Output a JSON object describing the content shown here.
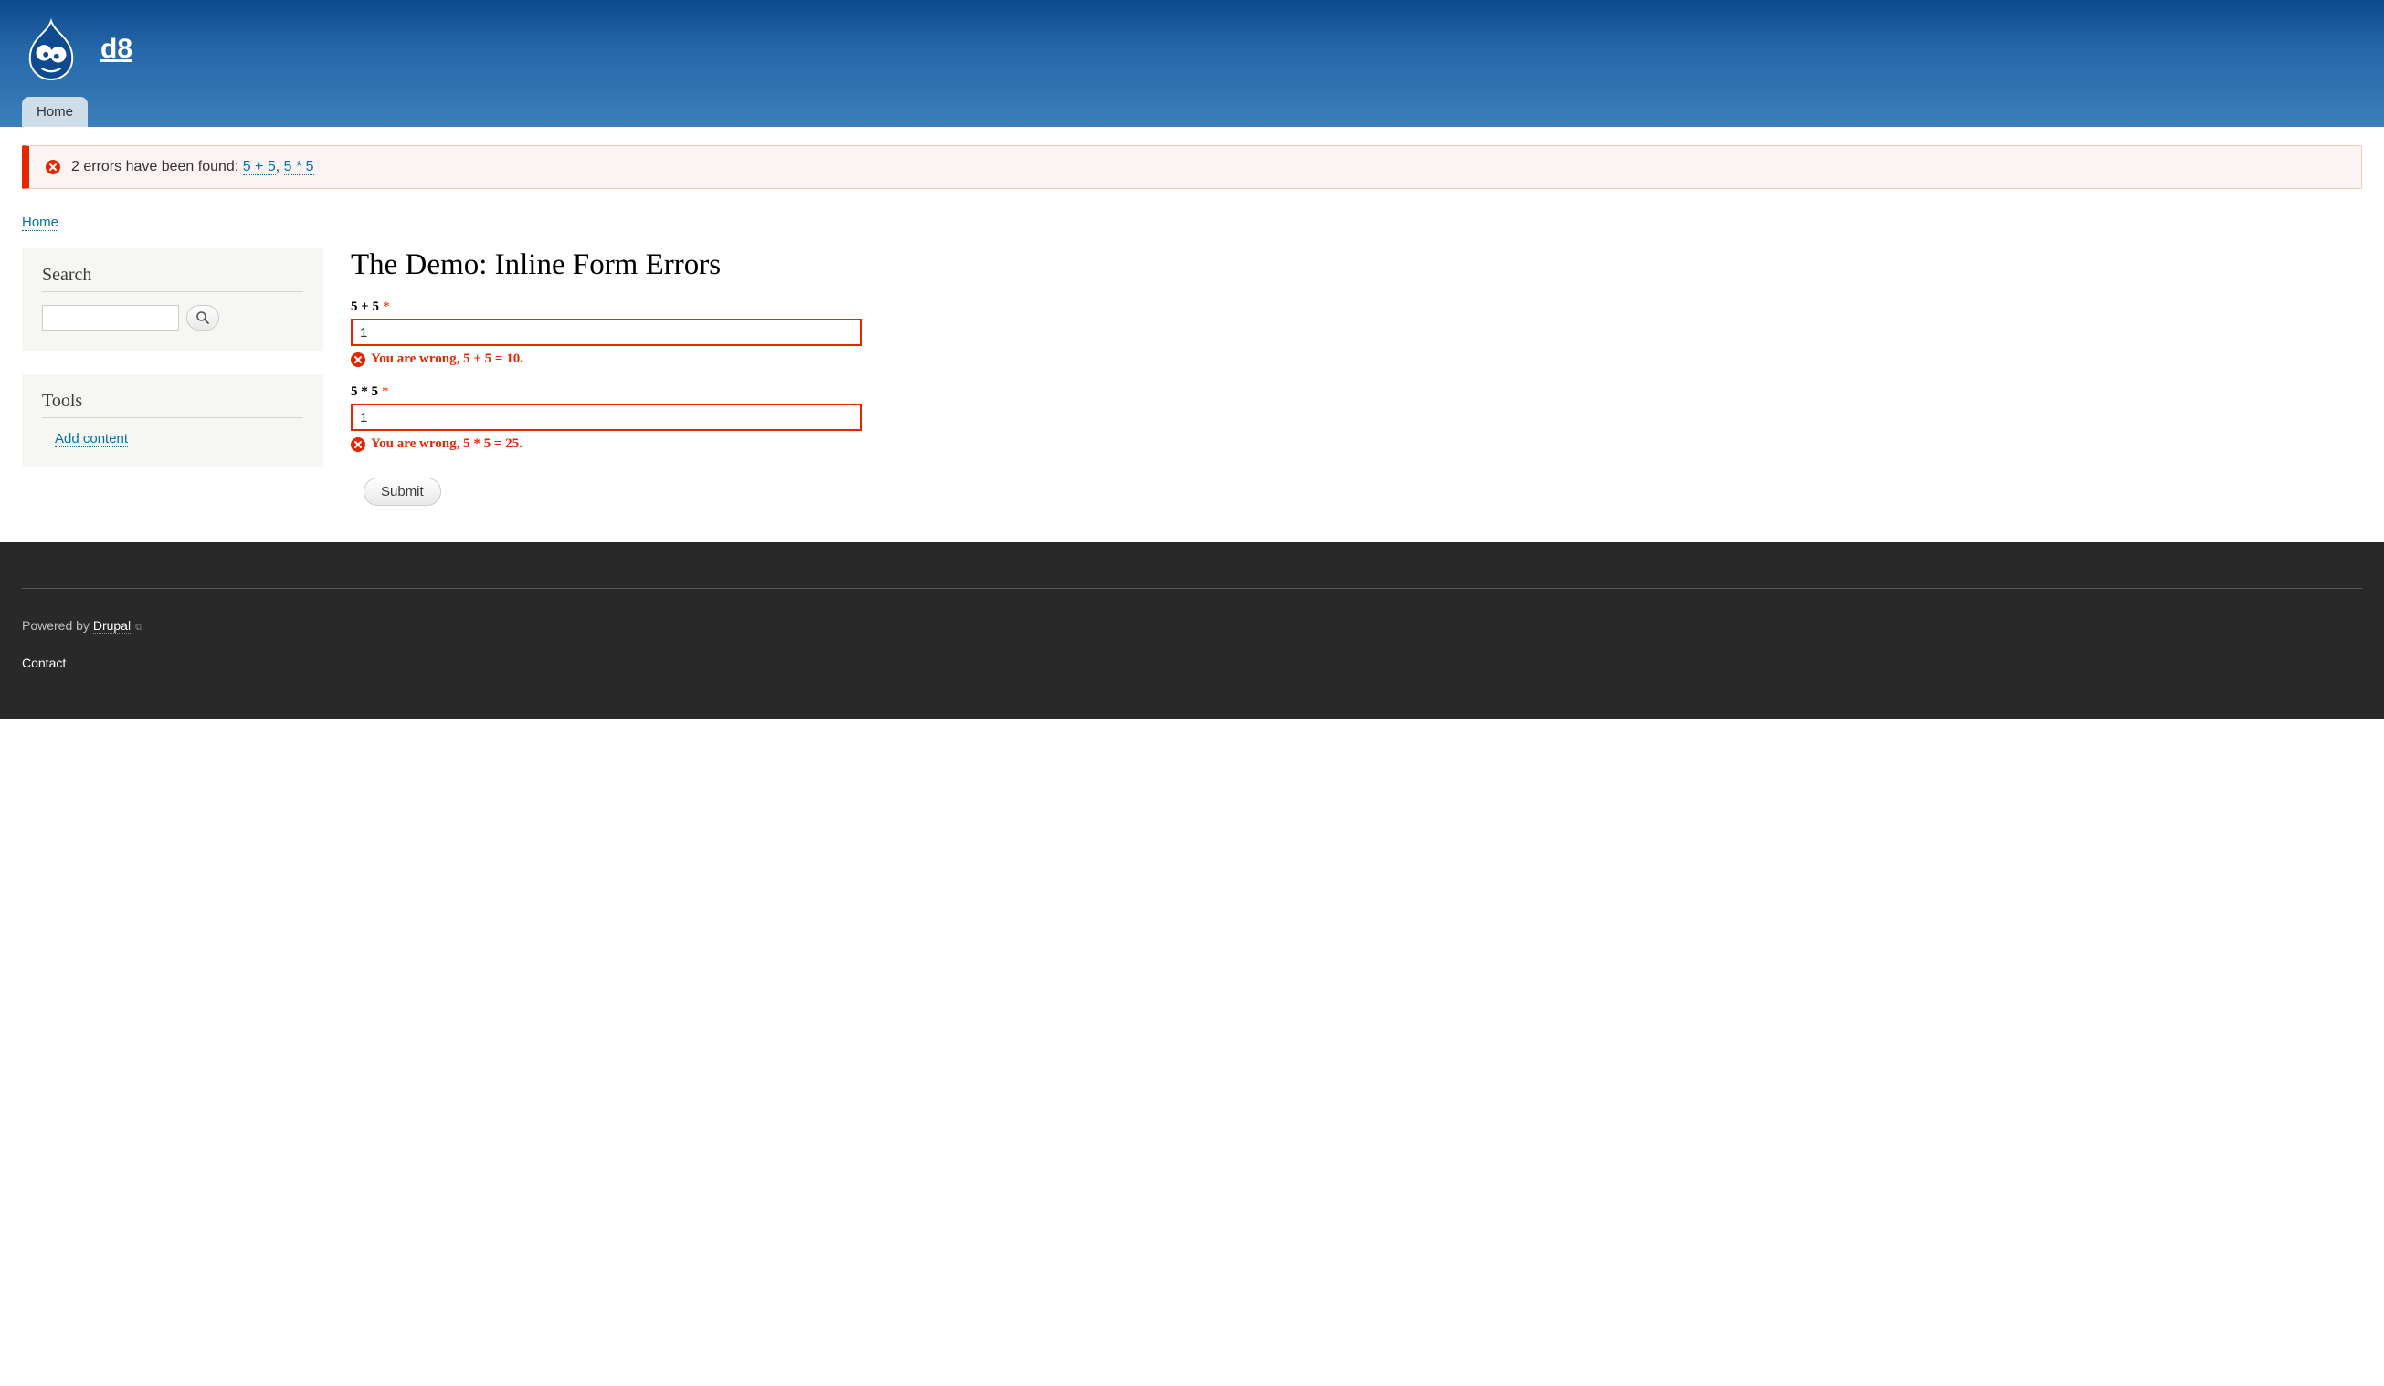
{
  "site": {
    "name": "d8"
  },
  "nav": {
    "home": "Home"
  },
  "messages": {
    "prefix": "2 errors have been found: ",
    "link1": "5 + 5",
    "sep": ", ",
    "link2": "5 * 5"
  },
  "breadcrumb": {
    "home": "Home"
  },
  "sidebar": {
    "search": {
      "title": "Search"
    },
    "tools": {
      "title": "Tools",
      "links": {
        "add_content": "Add content"
      }
    }
  },
  "page": {
    "title": "The Demo: Inline Form Errors"
  },
  "form": {
    "field1": {
      "label": "5 + 5",
      "value": "1",
      "error": "You are wrong, 5 + 5 = 10."
    },
    "field2": {
      "label": "5 * 5",
      "value": "1",
      "error": "You are wrong, 5 * 5 = 25."
    },
    "required": "*",
    "submit": "Submit"
  },
  "footer": {
    "powered_prefix": "Powered by ",
    "powered_link": "Drupal",
    "contact": "Contact"
  }
}
